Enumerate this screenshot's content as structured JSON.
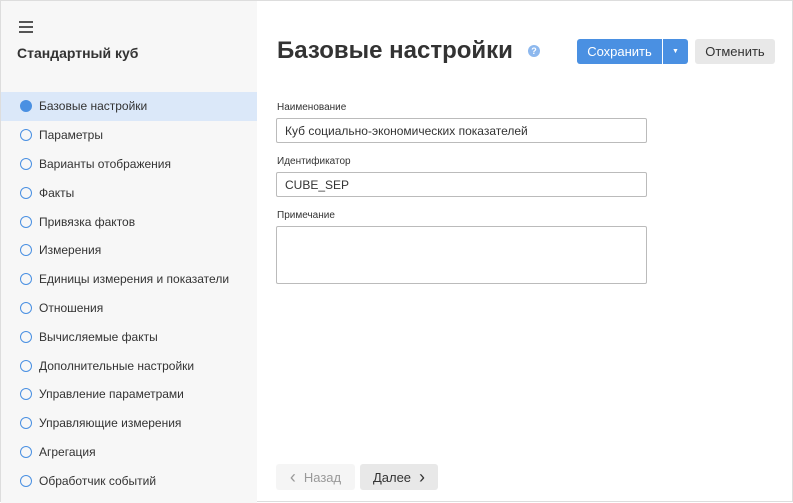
{
  "sidebar": {
    "title": "Стандартный куб",
    "items": [
      {
        "label": "Базовые настройки",
        "active": true
      },
      {
        "label": "Параметры"
      },
      {
        "label": "Варианты отображения"
      },
      {
        "label": "Факты"
      },
      {
        "label": "Привязка фактов"
      },
      {
        "label": "Измерения"
      },
      {
        "label": "Единицы измерения и показатели"
      },
      {
        "label": "Отношения"
      },
      {
        "label": "Вычисляемые факты"
      },
      {
        "label": "Дополнительные настройки"
      },
      {
        "label": "Управление параметрами"
      },
      {
        "label": "Управляющие измерения"
      },
      {
        "label": "Агрегация"
      },
      {
        "label": "Обработчик событий"
      }
    ]
  },
  "header": {
    "title": "Базовые настройки",
    "help": "?",
    "save": "Сохранить",
    "dropdown": "▼",
    "cancel": "Отменить"
  },
  "form": {
    "name_label": "Наименование",
    "name_value": "Куб социально-экономических показателей",
    "id_label": "Идентификатор",
    "id_value": "CUBE_SEP",
    "note_label": "Примечание",
    "note_value": ""
  },
  "footer": {
    "back": "Назад",
    "back_icon": "‹",
    "next": "Далее",
    "next_icon": "›"
  }
}
